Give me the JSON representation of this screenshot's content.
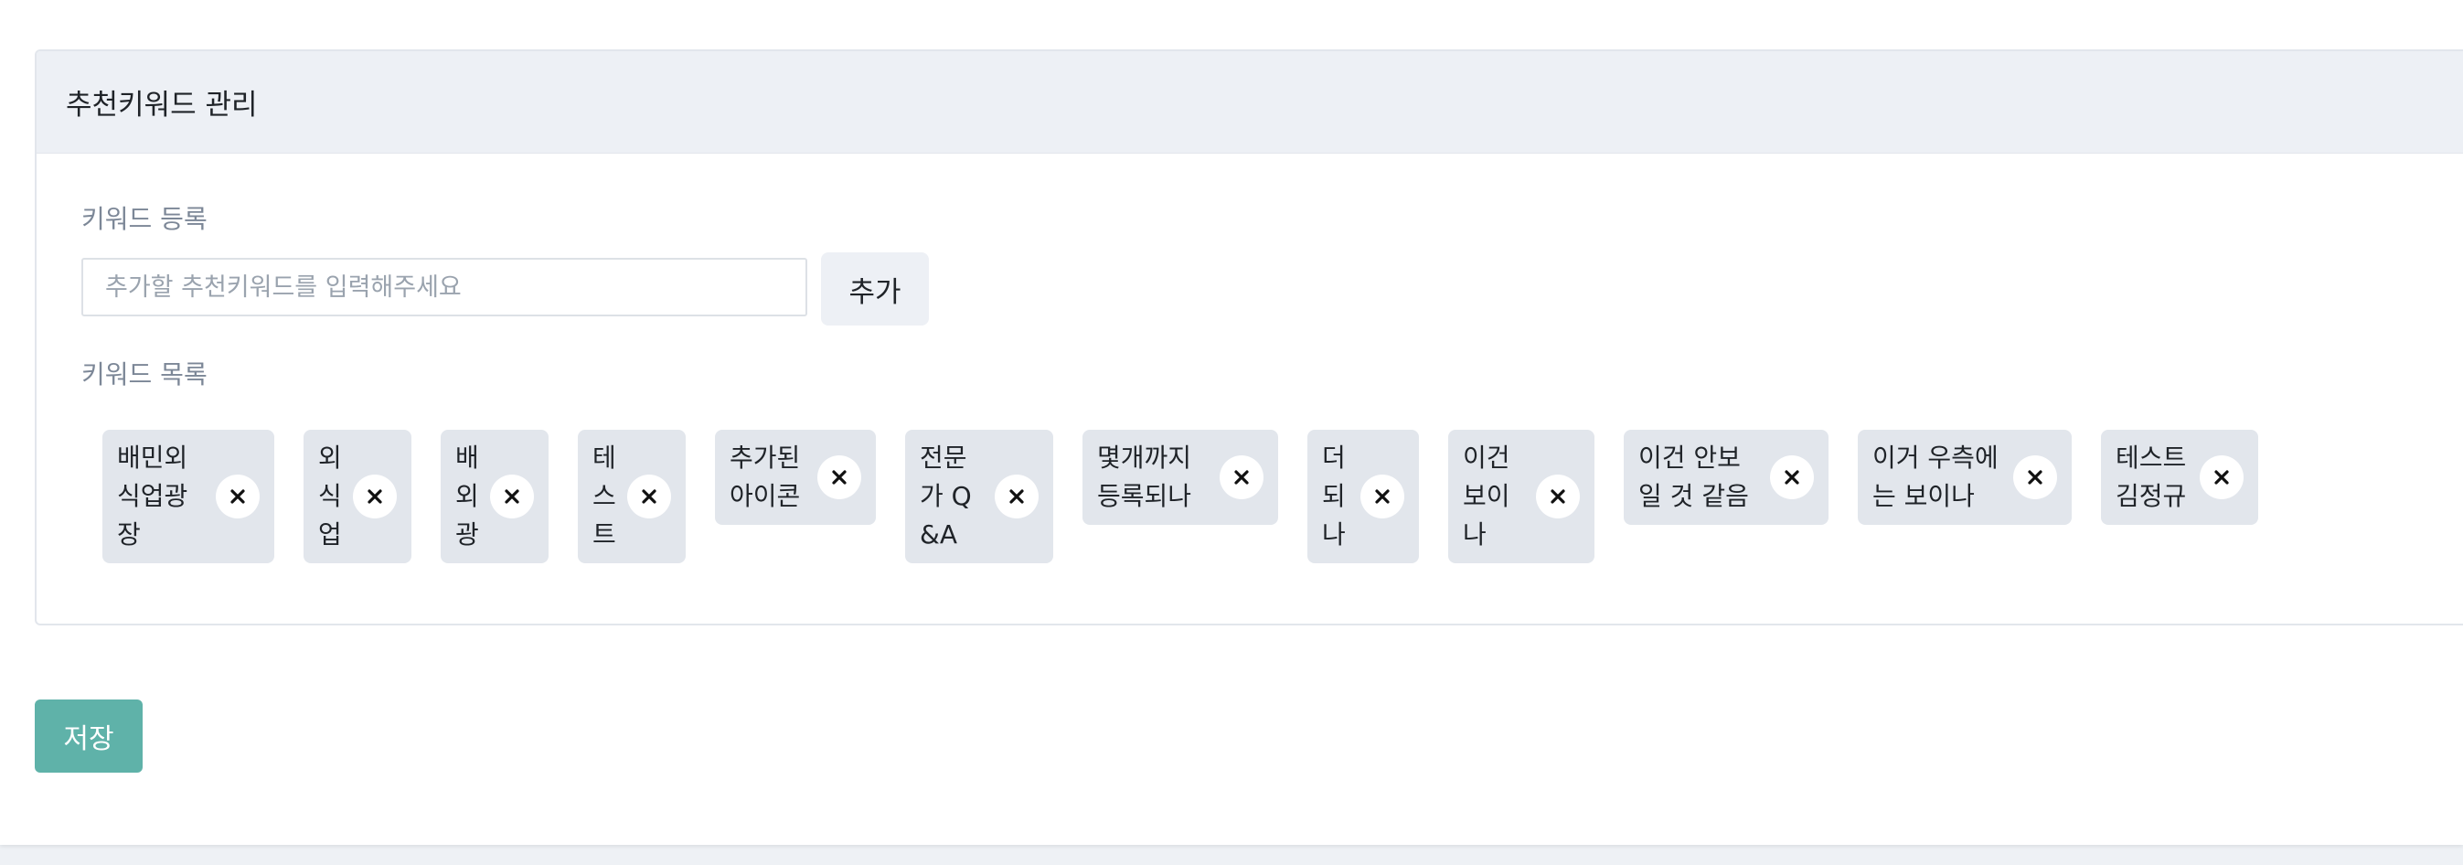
{
  "card": {
    "title": "추천키워드 관리"
  },
  "register": {
    "label": "키워드 등록",
    "placeholder": "추가할 추천키워드를 입력해주세요",
    "value": "",
    "add_label": "추가"
  },
  "list": {
    "label": "키워드 목록",
    "keywords": [
      "배민외식업광장",
      "외식업",
      "배외광",
      "테스트",
      "추가된 아이콘",
      "전문가 Q&A",
      "몇개까지 등록되나",
      "더되나",
      "이건 보이나",
      "이건 안보일 것 같음",
      "이거 우측에는 보이나",
      "테스트 김정규"
    ],
    "remove_icon": "close-icon"
  },
  "footer": {
    "save_label": "저장"
  },
  "colors": {
    "accent": "#5fb2a9",
    "chip_bg": "#e2e6ec",
    "header_bg": "#edf0f5"
  }
}
